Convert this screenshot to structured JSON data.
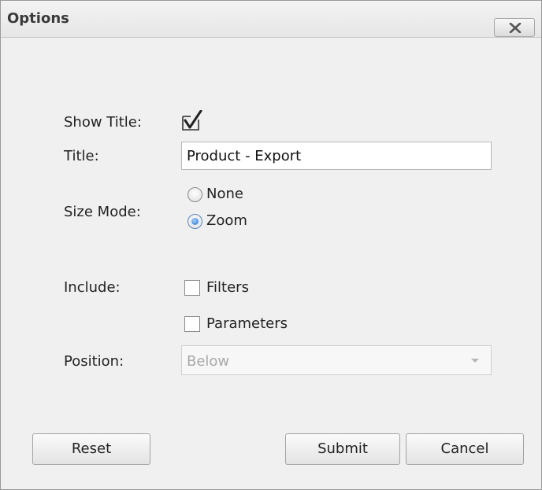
{
  "dialog": {
    "title": "Options"
  },
  "show_title": {
    "label": "Show Title:",
    "checked": true
  },
  "title_field": {
    "label": "Title:",
    "value": "Product - Export"
  },
  "size_mode": {
    "label": "Size Mode:",
    "options": [
      "None",
      "Zoom"
    ],
    "selected": "Zoom"
  },
  "include": {
    "label": "Include:",
    "options": [
      {
        "label": "Filters",
        "checked": false
      },
      {
        "label": "Parameters",
        "checked": false
      }
    ]
  },
  "position": {
    "label": "Position:",
    "value": "Below",
    "disabled": true
  },
  "buttons": {
    "reset": "Reset",
    "submit": "Submit",
    "cancel": "Cancel"
  },
  "icons": {
    "close": "close-icon",
    "check": "check-icon",
    "dropdown": "chevron-down-icon"
  },
  "colors": {
    "radio_selected": "#2f6fc4",
    "disabled_text": "#a8a8a8"
  }
}
